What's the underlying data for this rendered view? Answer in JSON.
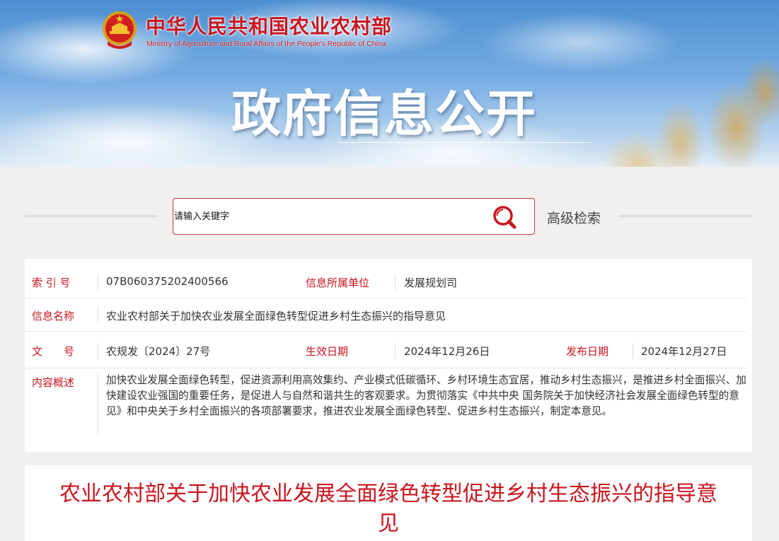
{
  "header": {
    "site_name_cn": "中华人民共和国农业农村部",
    "site_name_en": "Ministry of Agriculture and Rural Affairs of the People's Republic of China",
    "banner_title": "政府信息公开"
  },
  "search": {
    "placeholder": "请输入关键字",
    "advanced_label": "高级检索"
  },
  "info": {
    "index_label": "索 引 号",
    "index_value": "07B060375202400566",
    "unit_label": "信息所属单位",
    "unit_value": "发展规划司",
    "name_label": "信息名称",
    "name_value": "农业农村部关于加快农业发展全面绿色转型促进乡村生态振兴的指导意见",
    "docno_label": "文　　号",
    "docno_value": "农规发〔2024〕27号",
    "effective_label": "生效日期",
    "effective_value": "2024年12月26日",
    "publish_label": "发布日期",
    "publish_value": "2024年12月27日",
    "summary_label": "内容概述",
    "summary_value": "加快农业发展全面绿色转型，促进资源利用高效集约、产业模式低碳循环、乡村环境生态宜居，推动乡村生态振兴，是推进乡村全面振兴、加快建设农业强国的重要任务，是促进人与自然和谐共生的客观要求。为贯彻落实《中共中央 国务院关于加快经济社会发展全面绿色转型的意见》和中央关于乡村全面振兴的各项部署要求，推进农业发展全面绿色转型、促进乡村生态振兴，制定本意见。"
  },
  "article": {
    "title": "农业农村部关于加快农业发展全面绿色转型促进乡村生态振兴的指导意见"
  },
  "colors": {
    "accent_red": "#c9151e",
    "page_bg": "#f1f0ef",
    "panel_bg": "#ffffff"
  },
  "icons": {
    "emblem": "national-emblem-icon",
    "search": "magnifier-icon"
  }
}
